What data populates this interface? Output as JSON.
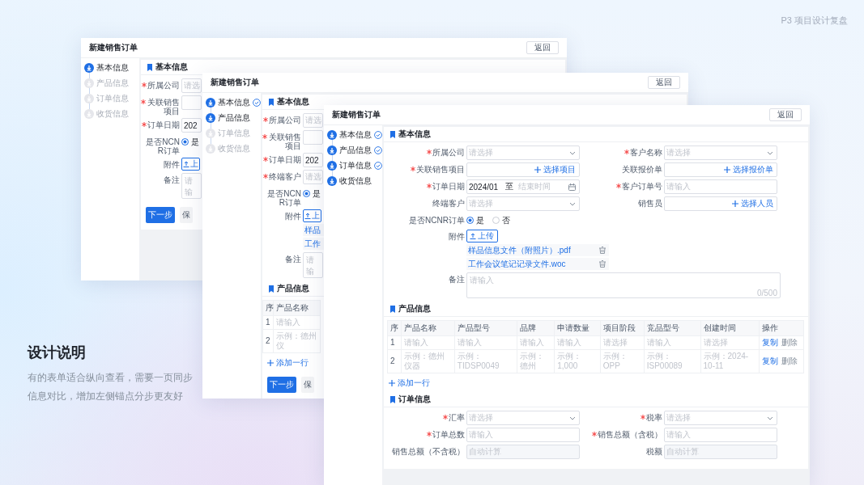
{
  "slide_title": "P3 项目设计复盘",
  "note": {
    "heading": "设计说明",
    "body": "有的表单适合纵向查看，需要一页同步信息对比，增加左侧锚点分步更友好"
  },
  "windows": [
    {
      "title": "新建销售订单",
      "back_button": "返回",
      "steps": [
        {
          "label": "基本信息",
          "active": true,
          "checked": false
        },
        {
          "label": "产品信息",
          "active": false,
          "checked": false
        },
        {
          "label": "订单信息",
          "active": false,
          "checked": false
        },
        {
          "label": "收货信息",
          "active": false,
          "checked": false
        }
      ],
      "blocks": [
        {
          "kind": "section",
          "title": "基本信息"
        },
        {
          "kind": "form",
          "rows": [
            {
              "fields": [
                {
                  "label": "所属公司",
                  "required": true,
                  "kind": "select",
                  "placeholder": "请选"
                }
              ]
            },
            {
              "fields": [
                {
                  "label": "关联销售项目",
                  "required": true,
                  "kind": "picker"
                }
              ]
            },
            {
              "fields": [
                {
                  "label": "订单日期",
                  "required": true,
                  "kind": "date",
                  "value": "202"
                }
              ]
            },
            {
              "fields": [
                {
                  "label": "是否NCNR订单",
                  "required": false,
                  "kind": "radio",
                  "options": [
                    {
                      "label": "是",
                      "selected": true
                    }
                  ]
                }
              ]
            },
            {
              "fields": [
                {
                  "label": "附件",
                  "required": false,
                  "kind": "upload",
                  "button": "上"
                }
              ]
            },
            {
              "fields": [
                {
                  "label": "备注",
                  "required": false,
                  "kind": "textarea",
                  "placeholder": "请输"
                }
              ]
            }
          ]
        },
        {
          "kind": "buttons",
          "buttons": [
            {
              "label": "下一步",
              "primary": true
            },
            {
              "label": "保",
              "primary": false
            }
          ]
        }
      ]
    },
    {
      "title": "新建销售订单",
      "back_button": "返回",
      "steps": [
        {
          "label": "基本信息",
          "active": true,
          "checked": true
        },
        {
          "label": "产品信息",
          "active": true,
          "checked": false
        },
        {
          "label": "订单信息",
          "active": false,
          "checked": false
        },
        {
          "label": "收货信息",
          "active": false,
          "checked": false
        }
      ],
      "blocks": [
        {
          "kind": "section",
          "title": "基本信息"
        },
        {
          "kind": "form",
          "rows": [
            {
              "fields": [
                {
                  "label": "所属公司",
                  "required": true,
                  "kind": "select",
                  "placeholder": "请选"
                }
              ]
            },
            {
              "fields": [
                {
                  "label": "关联销售项目",
                  "required": true,
                  "kind": "picker"
                }
              ]
            },
            {
              "fields": [
                {
                  "label": "订单日期",
                  "required": true,
                  "kind": "date",
                  "value": "202"
                }
              ]
            },
            {
              "fields": [
                {
                  "label": "终端客户",
                  "required": true,
                  "kind": "select",
                  "placeholder": "请选"
                }
              ]
            },
            {
              "fields": [
                {
                  "label": "是否NCNR订单",
                  "required": false,
                  "kind": "radio",
                  "options": [
                    {
                      "label": "是",
                      "selected": true
                    }
                  ]
                }
              ]
            },
            {
              "fields": [
                {
                  "label": "附件",
                  "required": false,
                  "kind": "upload",
                  "button": "上",
                  "files": [
                    {
                      "name": "样品"
                    },
                    {
                      "name": "工作"
                    }
                  ]
                }
              ]
            },
            {
              "fields": [
                {
                  "label": "备注",
                  "required": false,
                  "kind": "textarea",
                  "placeholder": "请输"
                }
              ]
            }
          ]
        },
        {
          "kind": "section",
          "title": "产品信息"
        },
        {
          "kind": "table",
          "columns": [
            "序",
            "产品名称"
          ],
          "rows": [
            {
              "cells": [
                "1",
                "请输入"
              ]
            },
            {
              "cells": [
                "2",
                "示例：德州仪"
              ]
            }
          ]
        },
        {
          "kind": "add_row",
          "label": "添加一行"
        },
        {
          "kind": "buttons",
          "buttons": [
            {
              "label": "下一步",
              "primary": true
            },
            {
              "label": "保",
              "primary": false
            }
          ]
        }
      ]
    },
    {
      "title": "新建销售订单",
      "back_button": "返回",
      "steps": [
        {
          "label": "基本信息",
          "active": true,
          "checked": true
        },
        {
          "label": "产品信息",
          "active": true,
          "checked": true
        },
        {
          "label": "订单信息",
          "active": true,
          "checked": true
        },
        {
          "label": "收货信息",
          "active": true,
          "checked": false
        }
      ],
      "blocks": [
        {
          "kind": "section",
          "title": "基本信息"
        },
        {
          "kind": "form",
          "rows": [
            {
              "fields": [
                {
                  "label": "所属公司",
                  "required": true,
                  "kind": "select",
                  "placeholder": "请选择"
                },
                {
                  "label": "客户名称",
                  "required": true,
                  "kind": "select",
                  "placeholder": "请选择"
                }
              ]
            },
            {
              "fields": [
                {
                  "label": "关联销售项目",
                  "required": true,
                  "kind": "picker",
                  "action": "选择项目"
                },
                {
                  "label": "关联报价单",
                  "required": false,
                  "kind": "picker",
                  "action": "选择报价单"
                }
              ]
            },
            {
              "fields": [
                {
                  "label": "订单日期",
                  "required": true,
                  "kind": "date",
                  "value": "2024/01",
                  "separator": "至",
                  "placeholder": "结束时间"
                },
                {
                  "label": "客户订单号",
                  "required": true,
                  "kind": "input",
                  "placeholder": "请输入"
                }
              ]
            },
            {
              "fields": [
                {
                  "label": "终端客户",
                  "required": false,
                  "kind": "select",
                  "placeholder": "请选择"
                },
                {
                  "label": "销售员",
                  "required": false,
                  "kind": "picker",
                  "action": "选择人员"
                }
              ]
            },
            {
              "fields": [
                {
                  "label": "是否NCNR订单",
                  "required": false,
                  "kind": "radio",
                  "options": [
                    {
                      "label": "是",
                      "selected": true
                    },
                    {
                      "label": "否",
                      "selected": false
                    }
                  ]
                }
              ]
            },
            {
              "fields": [
                {
                  "label": "附件",
                  "required": false,
                  "kind": "upload",
                  "button": "上传",
                  "files": [
                    {
                      "name": "样品信息文件（附照片）.pdf",
                      "removable": true
                    },
                    {
                      "name": "工作会议笔记记录文件.woc",
                      "removable": true
                    }
                  ]
                }
              ]
            },
            {
              "fields": [
                {
                  "label": "备注",
                  "required": false,
                  "kind": "textarea",
                  "placeholder": "请输入",
                  "counter": "0/500"
                }
              ]
            }
          ]
        },
        {
          "kind": "section",
          "title": "产品信息"
        },
        {
          "kind": "table",
          "columns": [
            "序",
            "产品名称",
            "产品型号",
            "品牌",
            "申请数量",
            "项目阶段",
            "竞品型号",
            "创建时间",
            "操作"
          ],
          "rows": [
            {
              "cells": [
                "1",
                "请输入",
                "请输入",
                "请输入",
                "请输入",
                "请选择",
                "请输入",
                "请选择"
              ],
              "actions": [
                {
                  "label": "复制",
                  "primary": true
                },
                {
                  "label": "删除",
                  "primary": false
                }
              ]
            },
            {
              "cells": [
                "2",
                "示例：德州仪器",
                "示例：TIDSP0049",
                "示例：德州",
                "示例：1,000",
                "示例：OPP",
                "示例：ISP00089",
                "示例：2024-10-11"
              ],
              "actions": [
                {
                  "label": "复制",
                  "primary": true
                },
                {
                  "label": "删除",
                  "primary": false
                }
              ]
            }
          ]
        },
        {
          "kind": "add_row",
          "label": "添加一行"
        },
        {
          "kind": "section",
          "title": "订单信息"
        },
        {
          "kind": "form",
          "rows": [
            {
              "fields": [
                {
                  "label": "汇率",
                  "required": true,
                  "kind": "select",
                  "placeholder": "请选择"
                },
                {
                  "label": "税率",
                  "required": true,
                  "kind": "select",
                  "placeholder": "请选择"
                }
              ]
            },
            {
              "fields": [
                {
                  "label": "订单总数",
                  "required": true,
                  "kind": "input",
                  "placeholder": "请输入"
                },
                {
                  "label": "销售总额（含税）",
                  "required": true,
                  "kind": "input",
                  "placeholder": "请输入"
                }
              ]
            },
            {
              "fields": [
                {
                  "label": "销售总额（不含税）",
                  "required": false,
                  "kind": "input",
                  "placeholder": "自动计算",
                  "disabled": true
                },
                {
                  "label": "税额",
                  "required": false,
                  "kind": "input",
                  "placeholder": "自动计算",
                  "disabled": true
                }
              ]
            }
          ]
        }
      ]
    }
  ]
}
